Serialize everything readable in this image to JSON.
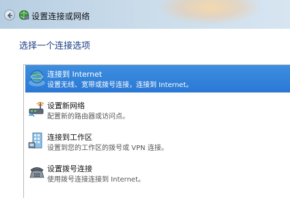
{
  "window": {
    "title": "设置连接或网络"
  },
  "main": {
    "heading": "选择一个连接选项",
    "options": [
      {
        "title": "连接到 Internet",
        "description": "设置无线、宽带或拨号连接，连接到 Internet。",
        "icon": "globe-network-icon",
        "selected": true
      },
      {
        "title": "设置新网络",
        "description": "配置新的路由器或访问点。",
        "icon": "router-icon",
        "selected": false
      },
      {
        "title": "连接到工作区",
        "description": "设置到您的工作区的拨号或 VPN 连接。",
        "icon": "workplace-icon",
        "selected": false
      },
      {
        "title": "设置拨号连接",
        "description": "使用拨号连接连接到 Internet。",
        "icon": "dialup-phone-icon",
        "selected": false
      }
    ]
  },
  "colors": {
    "selection": "#2a78d4",
    "heading": "#1e3e86"
  }
}
